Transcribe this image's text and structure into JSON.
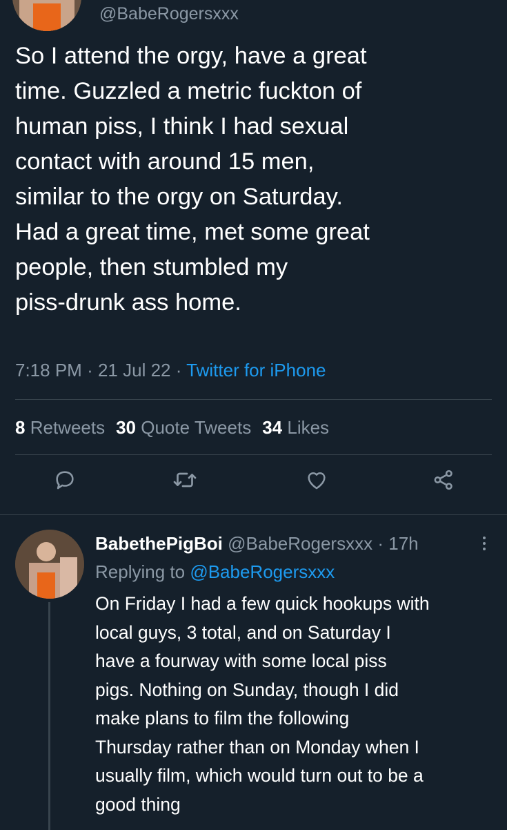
{
  "main_tweet": {
    "handle": "@BabeRogersxxx",
    "text_lines": [
      "So I attend the orgy, have a great",
      "time. Guzzled a metric fuckton of",
      "human piss, I think I had sexual",
      "contact with around 15 men,",
      "similar to the orgy on Saturday.",
      "Had a great time, met some great",
      "people, then stumbled my",
      "piss-drunk ass home."
    ],
    "time": "7:18 PM",
    "separator": "·",
    "date": "21 Jul 22",
    "source": "Twitter for iPhone",
    "stats": {
      "retweets_count": "8",
      "retweets_label": "Retweets",
      "quotes_count": "30",
      "quotes_label": "Quote Tweets",
      "likes_count": "34",
      "likes_label": "Likes"
    },
    "actions": [
      "reply-icon",
      "retweet-icon",
      "like-icon",
      "share-icon"
    ]
  },
  "reply": {
    "display_name": "BabethePigBoi",
    "handle": "@BabeRogersxxx",
    "separator": "·",
    "age": "17h",
    "replying_label": "Replying to",
    "replying_to": "@BabeRogersxxx",
    "text_lines": [
      "On Friday I had a few quick hookups with",
      "local guys, 3 total, and on Saturday I",
      "have a fourway with some local piss",
      "pigs. Nothing on Sunday, though I did",
      "make plans to film the following",
      "Thursday rather than on Monday when I",
      "usually film, which would turn out to be a",
      "good thing"
    ]
  },
  "colors": {
    "background": "#15202b",
    "text": "#ffffff",
    "secondary": "#8b98a5",
    "accent": "#1d9bf0",
    "divider": "#38444d"
  }
}
